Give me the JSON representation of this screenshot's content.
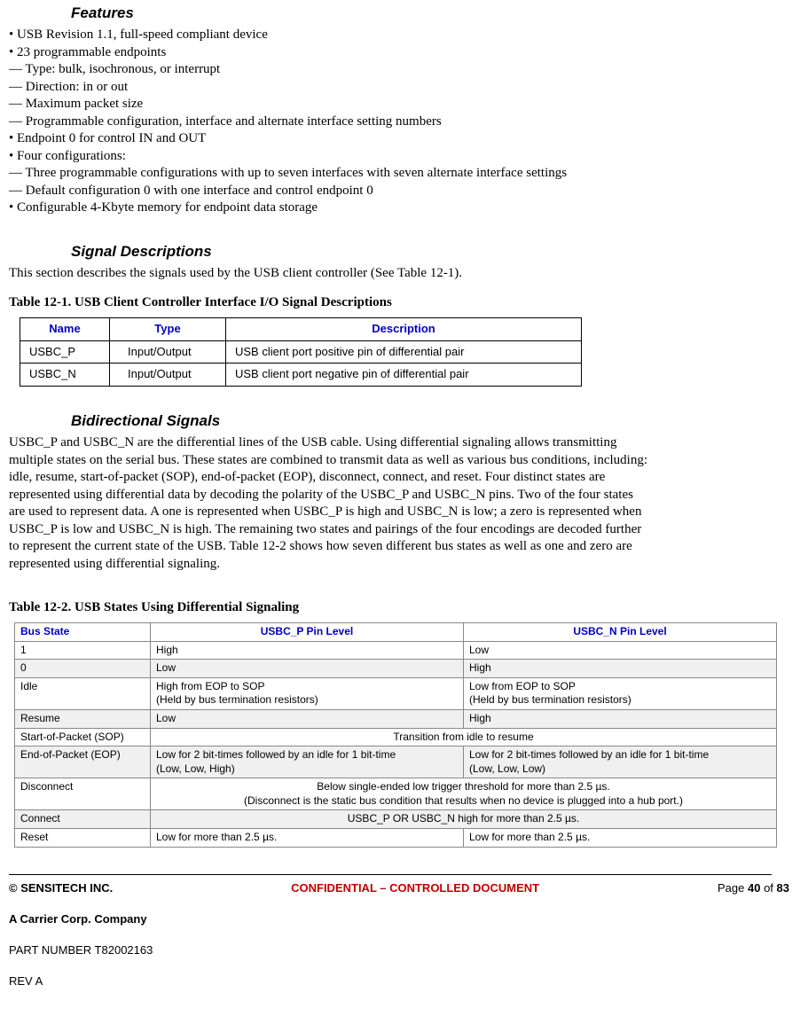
{
  "features": {
    "heading": "Features",
    "lines": [
      "• USB Revision 1.1, full-speed compliant device",
      "• 23 programmable endpoints",
      "— Type: bulk, isochronous, or interrupt",
      "— Direction: in or out",
      "— Maximum packet size",
      "— Programmable configuration, interface and alternate interface setting numbers",
      "• Endpoint 0 for control IN and OUT",
      "• Four configurations:",
      "— Three programmable configurations with up to seven interfaces with seven alternate interface settings",
      "— Default configuration 0 with one interface and control endpoint 0",
      "• Configurable 4-Kbyte memory for endpoint data storage"
    ]
  },
  "signal": {
    "heading": "Signal Descriptions",
    "intro": "This section describes the signals used by the USB client controller (See Table 12-1).",
    "table_caption": "Table 12-1. USB Client Controller Interface I/O Signal Descriptions",
    "headers": {
      "name": "Name",
      "type": "Type",
      "desc": "Description"
    },
    "rows": [
      {
        "name": "USBC_P",
        "type": "Input/Output",
        "desc": "USB client port positive pin of differential pair"
      },
      {
        "name": "USBC_N",
        "type": "Input/Output",
        "desc": "USB client port negative pin of differential pair"
      }
    ]
  },
  "bidi": {
    "heading": "Bidirectional Signals",
    "para": "USBC_P and USBC_N are the differential lines of the USB cable. Using differential signaling allows transmitting multiple states on the serial bus. These states are combined to transmit data as well as various bus conditions, including: idle, resume, start-of-packet (SOP), end-of-packet (EOP), disconnect, connect, and reset. Four distinct states are represented using differential data by decoding the polarity of the USBC_P and USBC_N pins. Two of the four states are used to represent data. A one is represented when USBC_P is high and USBC_N is low; a zero is represented when USBC_P is low and USBC_N is high. The remaining two states and pairings of the four encodings are decoded further to represent the current state of the USB. Table 12-2 shows how seven different bus states as well as one and zero are represented using differential signaling."
  },
  "t122": {
    "caption": "Table 12-2. USB States Using Differential Signaling",
    "headers": {
      "bs": "Bus State",
      "pp": "USBC_P Pin Level",
      "np": "USBC_N Pin Level"
    },
    "rows": [
      {
        "bs": "1",
        "pp": "High",
        "np": "Low",
        "span": false,
        "odd": false
      },
      {
        "bs": "0",
        "pp": "Low",
        "np": "High",
        "span": false,
        "odd": true
      },
      {
        "bs": "Idle",
        "pp": "High from EOP to SOP\n(Held by bus termination resistors)",
        "np": "Low from EOP to SOP\n(Held by bus termination resistors)",
        "span": false,
        "odd": false
      },
      {
        "bs": "Resume",
        "pp": "Low",
        "np": "High",
        "span": false,
        "odd": true
      },
      {
        "bs": "Start-of-Packet (SOP)",
        "pp": "Transition from idle to resume",
        "np": "",
        "span": true,
        "odd": false
      },
      {
        "bs": "End-of-Packet (EOP)",
        "pp": "Low for 2 bit-times followed by an idle for 1 bit-time\n(Low, Low, High)",
        "np": "Low for 2 bit-times followed by an idle for 1 bit-time\n(Low, Low, Low)",
        "span": false,
        "odd": true
      },
      {
        "bs": "Disconnect",
        "pp": "Below single-ended low trigger threshold for more than 2.5 µs.\n(Disconnect is the static bus condition that results when no device is plugged into a hub port.)",
        "np": "",
        "span": true,
        "odd": false
      },
      {
        "bs": "Connect",
        "pp": "USBC_P OR USBC_N high for more than 2.5 µs.",
        "np": "",
        "span": true,
        "odd": true
      },
      {
        "bs": "Reset",
        "pp": "Low for more than 2.5 µs.",
        "np": "Low for more than 2.5 µs.",
        "span": false,
        "odd": false
      }
    ]
  },
  "footer": {
    "left": "© SENSITECH INC.",
    "mid": "CONFIDENTIAL – CONTROLLED DOCUMENT",
    "page_prefix": "Page ",
    "page_num": "40",
    "page_of": " of ",
    "page_total": "83",
    "company": "A Carrier Corp. Company",
    "part": "PART NUMBER T82002163",
    "rev": "REV A"
  }
}
